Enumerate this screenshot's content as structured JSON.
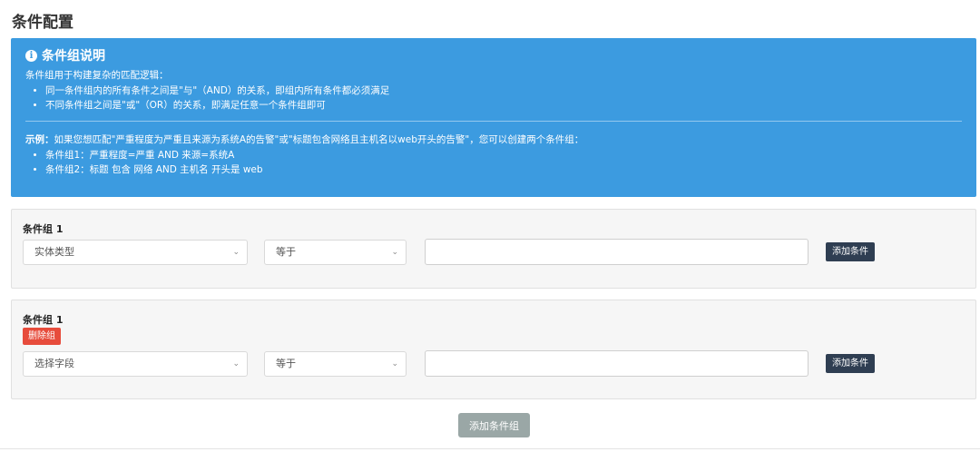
{
  "page": {
    "title": "条件配置"
  },
  "info": {
    "title": "条件组说明",
    "intro": "条件组用于构建复杂的匹配逻辑：",
    "rules": [
      "同一条件组内的所有条件之间是\"与\"（AND）的关系，即组内所有条件都必须满足",
      "不同条件组之间是\"或\"（OR）的关系，即满足任意一个条件组即可"
    ],
    "example_label": "示例：",
    "example_text": "如果您想匹配\"严重程度为严重且来源为系统A的告警\"或\"标题包含网络且主机名以web开头的告警\"，您可以创建两个条件组：",
    "examples": [
      "条件组1：严重程度=严重 AND 来源=系统A",
      "条件组2：标题 包含 网络 AND 主机名 开头是 web"
    ]
  },
  "groups": [
    {
      "title": "条件组 1",
      "field_select": "实体类型",
      "operator_select": "等于",
      "value": "",
      "add_condition_label": "添加条件"
    },
    {
      "title": "条件组 1",
      "delete_label": "删除组",
      "field_select": "选择字段",
      "operator_select": "等于",
      "value": "",
      "add_condition_label": "添加条件"
    }
  ],
  "add_group_label": "添加条件组",
  "colors": {
    "info_bg": "#3c9be0",
    "delete": "#e74c3c",
    "add_condition": "#2f3e52",
    "add_group": "#9aa7a6"
  }
}
